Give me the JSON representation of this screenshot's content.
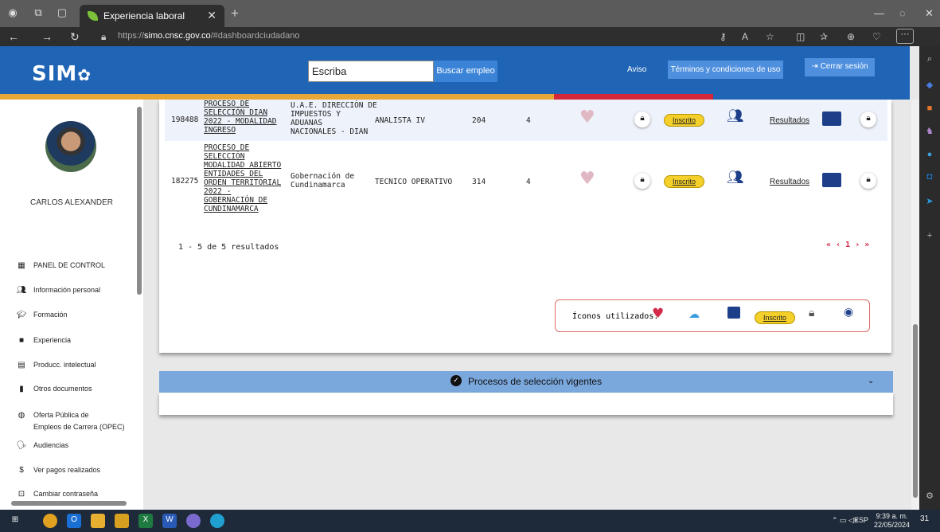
{
  "browser": {
    "tab_title": "Experiencia laboral",
    "url_prefix": "https://",
    "url_domain": "simo.cnsc.gov.co",
    "url_path": "/#dashboardciudadano"
  },
  "header": {
    "logo": "SIM",
    "search_value": "Escriba",
    "search_button": "Buscar empleo",
    "aviso": "Aviso",
    "terms": "Términos y condiciones de uso",
    "logout": "Cerrar sesión"
  },
  "user": {
    "name": "CARLOS ALEXANDER"
  },
  "menu": [
    {
      "label": "PANEL DE CONTROL",
      "icon": "dashboard-icon"
    },
    {
      "label": "Información personal",
      "icon": "people-icon"
    },
    {
      "label": "Formación",
      "icon": "graduation-icon"
    },
    {
      "label": "Experiencia",
      "icon": "briefcase-icon"
    },
    {
      "label": "Producc. intelectual",
      "icon": "document-icon"
    },
    {
      "label": "Otros documentos",
      "icon": "file-icon"
    },
    {
      "label": "Oferta Pública de",
      "label2": "Empleos de Carrera (OPEC)",
      "icon": "globe-icon"
    },
    {
      "label": "Audiencias",
      "icon": "speaker-icon"
    },
    {
      "label": "Ver pagos realizados",
      "icon": "dollar-icon"
    },
    {
      "label": "Cambiar contraseña",
      "icon": "lock-icon"
    }
  ],
  "rows": [
    {
      "id": "198488",
      "process": [
        "PROCESO DE",
        "SELECCIÓN DIAN",
        "2022 - MODALIDAD",
        "INGRESO"
      ],
      "entity": [
        "U.A.E. DIRECCIÓN DE",
        "IMPUESTOS Y",
        "ADUANAS",
        "NACIONALES - DIAN"
      ],
      "job": "ANALISTA IV",
      "code": "204",
      "grade": "4",
      "status": "Inscrito",
      "results": "Resultados"
    },
    {
      "id": "182275",
      "process": [
        "PROCESO DE",
        "SELECCIÓN",
        "MODALIDAD ABIERTO",
        "ENTIDADES DEL",
        "ORDEN TERRITORIAL",
        "2022 -",
        "GOBERNACIÓN DE",
        "CUNDINAMARCA"
      ],
      "entity": [
        "Gobernación de",
        "Cundinamarca"
      ],
      "job": "TECNICO OPERATIVO",
      "code": "314",
      "grade": "4",
      "status": "Inscrito",
      "results": "Resultados"
    }
  ],
  "pagination": {
    "summary": "1 - 5 de 5 resultados",
    "first": "«",
    "prev": "‹",
    "page": "1",
    "next": "›",
    "last": "»"
  },
  "legend": {
    "label": "Íconos utilizados:",
    "badge": "Inscrito"
  },
  "processes_bar": {
    "title": "Procesos de selección vigentes"
  },
  "taskbar": {
    "lang": "ESP",
    "time": "9:39 a. m.",
    "date": "22/05/2024",
    "notif": "31"
  },
  "colors": {
    "header_blue": "#1f64b5",
    "badge_yellow": "#f5d02b",
    "heart_pink": "#e0b8c4",
    "brand_dark_blue": "#1d3f8a",
    "pagination_red": "#d42a4a"
  }
}
